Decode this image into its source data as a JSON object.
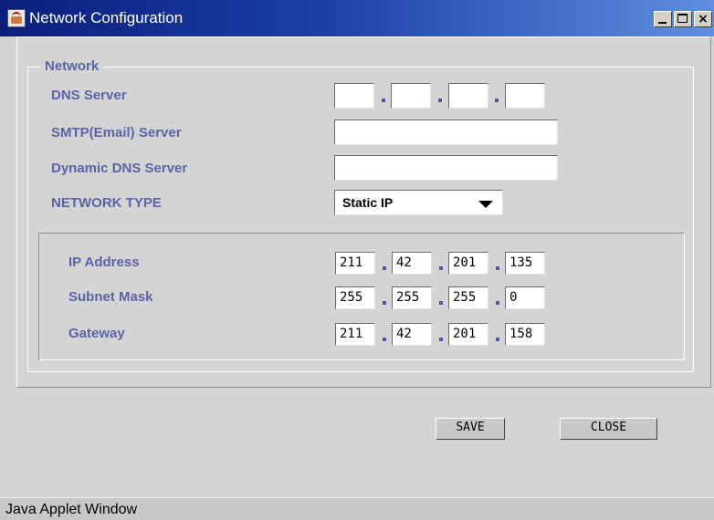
{
  "window": {
    "title": "Network Configuration",
    "status": "Java Applet Window"
  },
  "network": {
    "legend": "Network",
    "dns_label": "DNS Server",
    "smtp_label": "SMTP(Email) Server",
    "ddns_label": "Dynamic DNS Server",
    "type_label": "NETWORK TYPE",
    "type_value": "Static IP",
    "dns": [
      "",
      "",
      "",
      ""
    ],
    "smtp": "",
    "ddns": ""
  },
  "static": {
    "ip_label": "IP Address",
    "subnet_label": "Subnet Mask",
    "gateway_label": "Gateway",
    "ip": [
      "211",
      "42",
      "201",
      "135"
    ],
    "subnet": [
      "255",
      "255",
      "255",
      "0"
    ],
    "gateway": [
      "211",
      "42",
      "201",
      "158"
    ]
  },
  "buttons": {
    "save": "SAVE",
    "close": "CLOSE"
  }
}
